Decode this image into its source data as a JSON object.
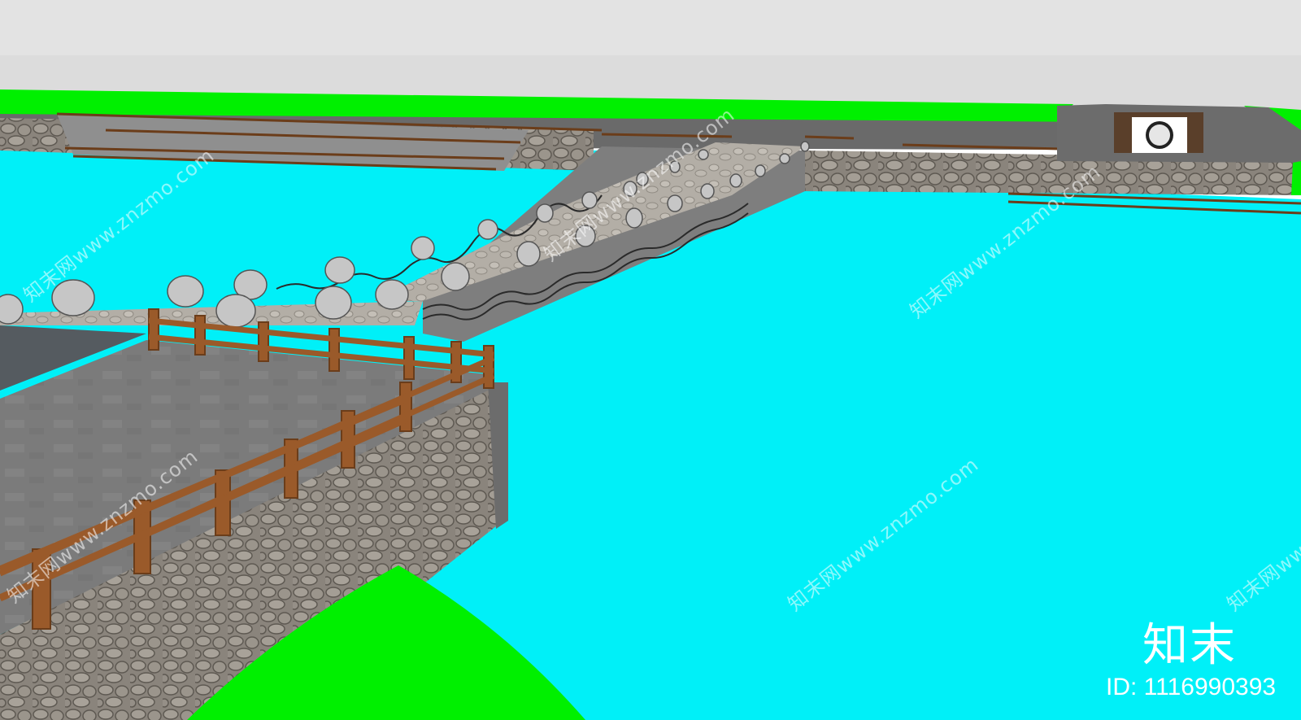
{
  "scene": {
    "colors": {
      "sky": "#e7e7e7",
      "water": "#00f0f8",
      "grass": "#00f000",
      "paving": "#7b7b7b",
      "stone_wall": "#8a847c",
      "wood_rail": "#9a5a2a",
      "stepping_stone": "#c9c9c9"
    }
  },
  "watermark": {
    "logo": "知末",
    "id_label": "ID: 1116990393",
    "diagonal_text": "知末网www.znzmo.com"
  }
}
